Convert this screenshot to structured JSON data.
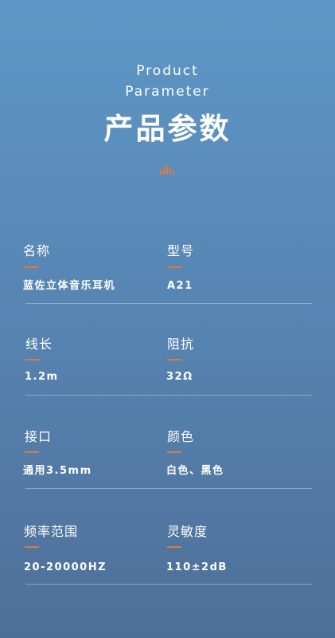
{
  "header": {
    "title_en_line1": "Product",
    "title_en_line2": "Parameter",
    "title_cn": "产品参数"
  },
  "accent_color": "#e07a3a",
  "params": [
    {
      "left": {
        "label": "名称",
        "value": "蓝佐立体音乐耳机"
      },
      "right": {
        "label": "型号",
        "value": "A21"
      }
    },
    {
      "left": {
        "label": "线长",
        "value": "1.2m"
      },
      "right": {
        "label": "阻抗",
        "value": "32Ω"
      }
    },
    {
      "left": {
        "label": "接口",
        "value": "通用3.5mm"
      },
      "right": {
        "label": "颜色",
        "value": "白色、黑色"
      }
    },
    {
      "left": {
        "label": "频率范围",
        "value": "20-20000HZ"
      },
      "right": {
        "label": "灵敏度",
        "value": "110±2dB"
      }
    }
  ]
}
